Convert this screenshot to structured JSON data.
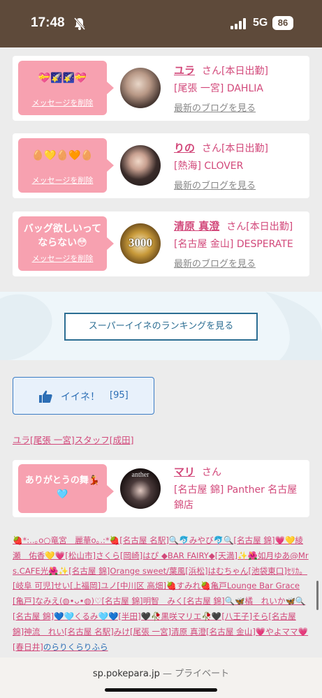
{
  "status_bar": {
    "time": "17:48",
    "network": "5G",
    "battery": "86"
  },
  "cards": [
    {
      "message": "💝🌠🌠💝",
      "delete_label": "メッセージを削除",
      "name": "ユラ",
      "honorific": "さん",
      "status": "[本日出勤]",
      "shop": "[尾張 一宮] DAHLIA",
      "blog_label": "最新のブログを見る"
    },
    {
      "message": "🥚💛🥚🧡🥚",
      "delete_label": "メッセージを削除",
      "name": "りの",
      "honorific": "さん",
      "status": "[本日出勤]",
      "shop": "[熱海] CLOVER",
      "blog_label": "最新のブログを見る"
    },
    {
      "message": "バッグ欲しいって\nならない😳",
      "delete_label": "メッセージを削除",
      "name": "清原 真澄",
      "honorific": "さん",
      "status": "[本日出勤]",
      "shop": "[名古屋 金山] DESPERATE",
      "blog_label": "最新のブログを見る",
      "avatar_text": "3000"
    }
  ],
  "ranking_button": "スーパーイイネのランキングを見る",
  "like": {
    "label": "イイネ！",
    "count": "[95]"
  },
  "staff_link": "ユラ[尾張 一宮]スタッフ[成田]",
  "staff_card": {
    "message": "ありがとうの舞💃\n🩵",
    "name": "マリ",
    "honorific": "さん",
    "shop": "[名古屋 錦] Panther 名古屋\n錦店"
  },
  "list_text": "🍓*:..｡o○竜宮　麗華o｡.:*🍓[名古屋 名駅]🔍🐬みやび🐬🔍[名古屋 錦]💗💛綾瀬　佑香💛💗[松山市]さくら[岡崎]はぴ ◆BAR FAIRY◆[天満]✨🌺如月ゆあ@Mrs.CAFE光🌺✨[名古屋 錦]Orange sweet/葉風[浜松]はむちゃん[池袋東口]ｾﾘｶ。[岐阜 可児]せい[上福岡]ユノ[中川区 高畑]🍓すみれ🍓亀戸Lounge Bar Grace[亀戸]なみえ(◍•ᴗ•◍)♡[名古屋 錦]明智　みく[名古屋 錦]🔍🦋橘　れいか🦋🔍[名古屋 錦]💙🩵くるみ🩵💙[半田]🖤🥀黒咲マリエ🥀🖤[八王子]そら[名古屋 錦]神流　れい[名古屋 名駅]みけ[尾張 一宮]清原 真澄[名古屋 金山]💗やよママ💗[春日井]",
  "list_tail": "のらりくらりふら",
  "url_bar": {
    "url": "sp.pokepara.jp",
    "privacy": "— プライベート"
  }
}
